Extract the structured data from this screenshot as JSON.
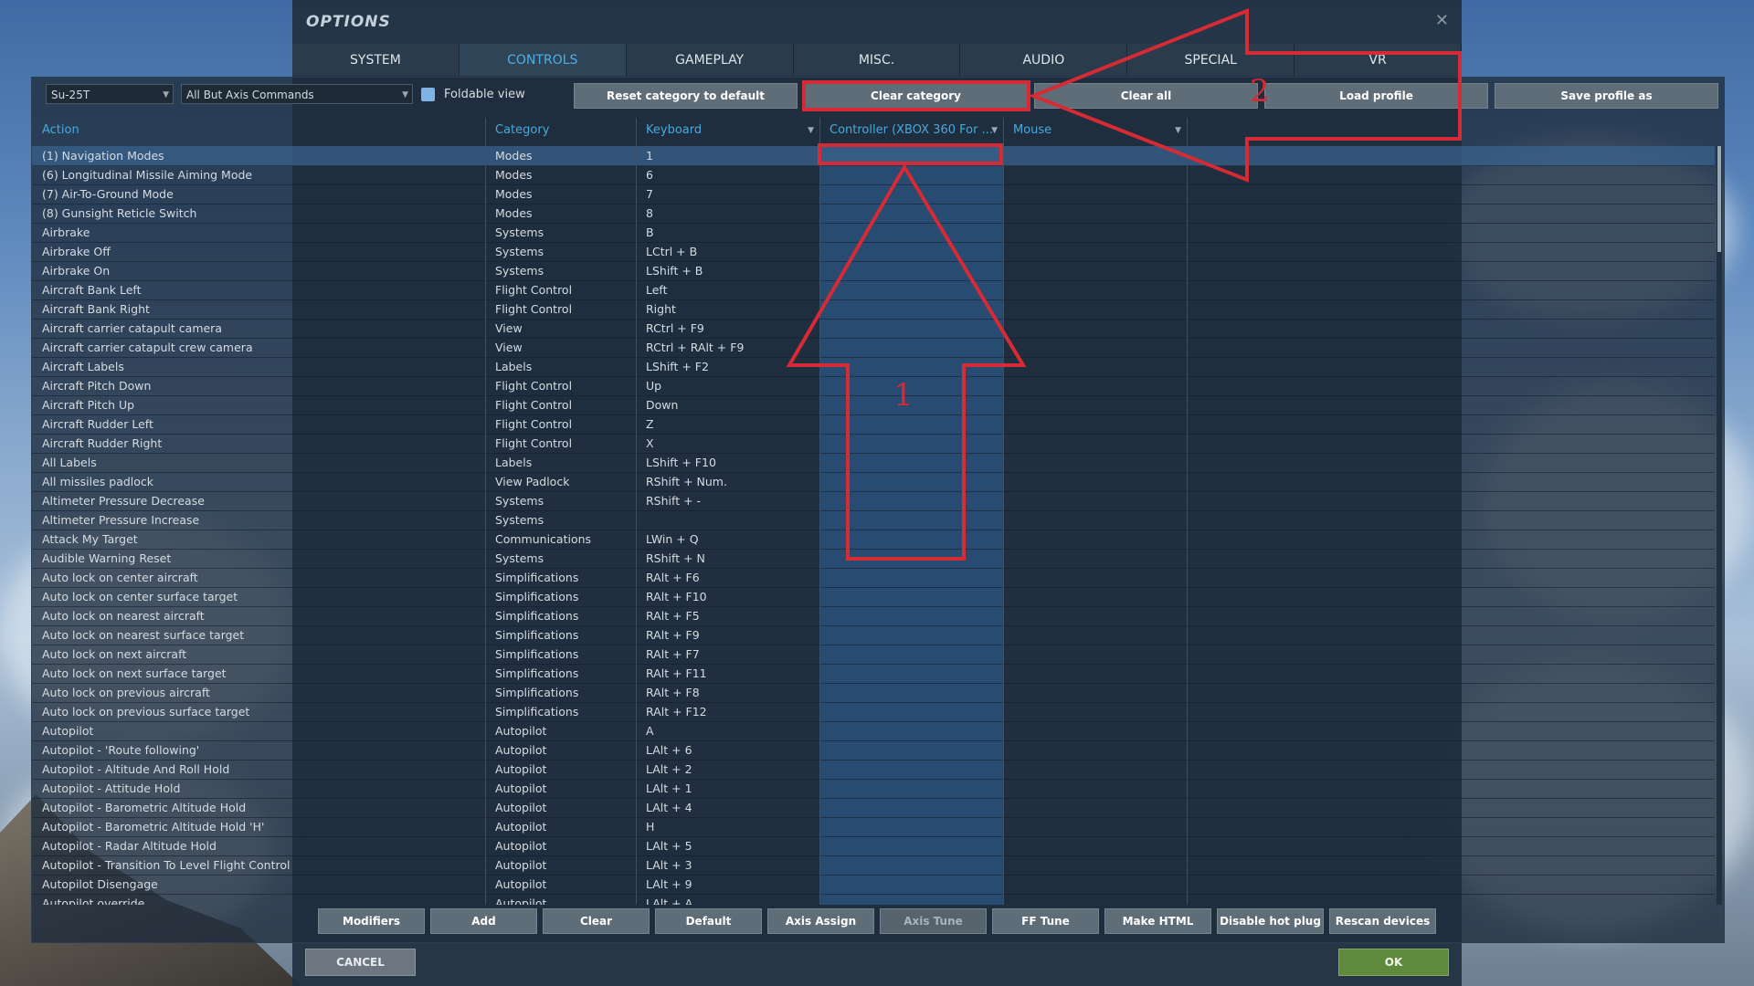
{
  "dialog": {
    "title": "OPTIONS"
  },
  "tabs": [
    "SYSTEM",
    "CONTROLS",
    "GAMEPLAY",
    "MISC.",
    "AUDIO",
    "SPECIAL",
    "VR"
  ],
  "active_tab": "CONTROLS",
  "toolbar": {
    "aircraft_select": "Su-25T",
    "category_select": "All But Axis Commands",
    "foldable_view_label": "Foldable view",
    "reset_category_label": "Reset category to default",
    "clear_category_label": "Clear category",
    "clear_all_label": "Clear all",
    "load_profile_label": "Load profile",
    "save_profile_as_label": "Save profile as"
  },
  "columns": {
    "action": "Action",
    "category": "Category",
    "keyboard": "Keyboard",
    "controller": "Controller (XBOX 360 For ...",
    "mouse": "Mouse"
  },
  "rows": [
    {
      "action": "(1) Navigation Modes",
      "category": "Modes",
      "keyboard": "1"
    },
    {
      "action": "(6) Longitudinal Missile Aiming Mode",
      "category": "Modes",
      "keyboard": "6"
    },
    {
      "action": "(7) Air-To-Ground Mode",
      "category": "Modes",
      "keyboard": "7"
    },
    {
      "action": "(8) Gunsight Reticle Switch",
      "category": "Modes",
      "keyboard": "8"
    },
    {
      "action": "Airbrake",
      "category": "Systems",
      "keyboard": "B"
    },
    {
      "action": "Airbrake Off",
      "category": "Systems",
      "keyboard": "LCtrl + B"
    },
    {
      "action": "Airbrake On",
      "category": "Systems",
      "keyboard": "LShift + B"
    },
    {
      "action": "Aircraft Bank Left",
      "category": "Flight Control",
      "keyboard": "Left"
    },
    {
      "action": "Aircraft Bank Right",
      "category": "Flight Control",
      "keyboard": "Right"
    },
    {
      "action": "Aircraft carrier catapult camera",
      "category": "View",
      "keyboard": "RCtrl + F9"
    },
    {
      "action": "Aircraft carrier catapult crew camera",
      "category": "View",
      "keyboard": "RCtrl + RAlt + F9"
    },
    {
      "action": "Aircraft Labels",
      "category": "Labels",
      "keyboard": "LShift + F2"
    },
    {
      "action": "Aircraft Pitch Down",
      "category": "Flight Control",
      "keyboard": "Up"
    },
    {
      "action": "Aircraft Pitch Up",
      "category": "Flight Control",
      "keyboard": "Down"
    },
    {
      "action": "Aircraft Rudder Left",
      "category": "Flight Control",
      "keyboard": "Z"
    },
    {
      "action": "Aircraft Rudder Right",
      "category": "Flight Control",
      "keyboard": "X"
    },
    {
      "action": "All Labels",
      "category": "Labels",
      "keyboard": "LShift + F10"
    },
    {
      "action": "All missiles padlock",
      "category": "View Padlock",
      "keyboard": "RShift + Num."
    },
    {
      "action": "Altimeter Pressure Decrease",
      "category": "Systems",
      "keyboard": "RShift + -"
    },
    {
      "action": "Altimeter Pressure Increase",
      "category": "Systems",
      "keyboard": ""
    },
    {
      "action": "Attack My Target",
      "category": "Communications",
      "keyboard": "LWin + Q"
    },
    {
      "action": "Audible Warning Reset",
      "category": "Systems",
      "keyboard": "RShift + N"
    },
    {
      "action": "Auto lock on center aircraft",
      "category": "Simplifications",
      "keyboard": "RAlt + F6"
    },
    {
      "action": "Auto lock on center surface target",
      "category": "Simplifications",
      "keyboard": "RAlt + F10"
    },
    {
      "action": "Auto lock on nearest aircraft",
      "category": "Simplifications",
      "keyboard": "RAlt + F5"
    },
    {
      "action": "Auto lock on nearest surface target",
      "category": "Simplifications",
      "keyboard": "RAlt + F9"
    },
    {
      "action": "Auto lock on next aircraft",
      "category": "Simplifications",
      "keyboard": "RAlt + F7"
    },
    {
      "action": "Auto lock on next surface target",
      "category": "Simplifications",
      "keyboard": "RAlt + F11"
    },
    {
      "action": "Auto lock on previous aircraft",
      "category": "Simplifications",
      "keyboard": "RAlt + F8"
    },
    {
      "action": "Auto lock on previous surface target",
      "category": "Simplifications",
      "keyboard": "RAlt + F12"
    },
    {
      "action": "Autopilot",
      "category": "Autopilot",
      "keyboard": "A"
    },
    {
      "action": "Autopilot - 'Route following'",
      "category": "Autopilot",
      "keyboard": "LAlt + 6"
    },
    {
      "action": "Autopilot - Altitude And Roll Hold",
      "category": "Autopilot",
      "keyboard": "LAlt + 2"
    },
    {
      "action": "Autopilot - Attitude Hold",
      "category": "Autopilot",
      "keyboard": "LAlt + 1"
    },
    {
      "action": "Autopilot - Barometric Altitude Hold",
      "category": "Autopilot",
      "keyboard": "LAlt + 4"
    },
    {
      "action": "Autopilot - Barometric Altitude Hold 'H'",
      "category": "Autopilot",
      "keyboard": "H"
    },
    {
      "action": "Autopilot - Radar Altitude Hold",
      "category": "Autopilot",
      "keyboard": "LAlt + 5"
    },
    {
      "action": "Autopilot - Transition To Level Flight Control",
      "category": "Autopilot",
      "keyboard": "LAlt + 3"
    },
    {
      "action": "Autopilot Disengage",
      "category": "Autopilot",
      "keyboard": "LAlt + 9"
    },
    {
      "action": "Autopilot override",
      "category": "Autopilot",
      "keyboard": "LAlt + A"
    }
  ],
  "bottom_buttons": [
    "Modifiers",
    "Add",
    "Clear",
    "Default",
    "Axis Assign",
    "Axis Tune",
    "FF Tune",
    "Make HTML",
    "Disable hot plug",
    "Rescan devices"
  ],
  "footer": {
    "cancel_label": "CANCEL",
    "ok_label": "OK"
  },
  "annotations": {
    "label_1": "1",
    "label_2": "2",
    "color": "#d62a35"
  }
}
